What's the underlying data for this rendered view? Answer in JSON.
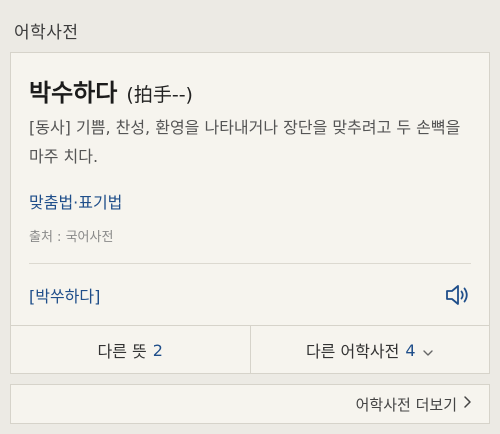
{
  "section": {
    "title": "어학사전"
  },
  "entry": {
    "headword": "박수하다",
    "hanja": "(拍手--)",
    "definition": "[동사] 기쁨, 찬성, 환영을 나타내거나 장단을 맞추려고 두 손뼉을 마주 치다.",
    "spelling_link": "맞춤법·표기법",
    "source": "출처 : 국어사전",
    "pronunciation": "[박쑤하다]"
  },
  "bottom": {
    "other_meanings_label": "다른 뜻",
    "other_meanings_count": "2",
    "other_dicts_label": "다른 어학사전",
    "other_dicts_count": "4"
  },
  "more": {
    "label": "어학사전 더보기"
  },
  "icons": {
    "speaker": "speaker-icon",
    "chevron_down": "chevron-down-icon",
    "chevron_right": "chevron-right-icon"
  },
  "colors": {
    "link": "#1f4e8a",
    "background": "#eceae4",
    "card": "#f6f4ee"
  }
}
